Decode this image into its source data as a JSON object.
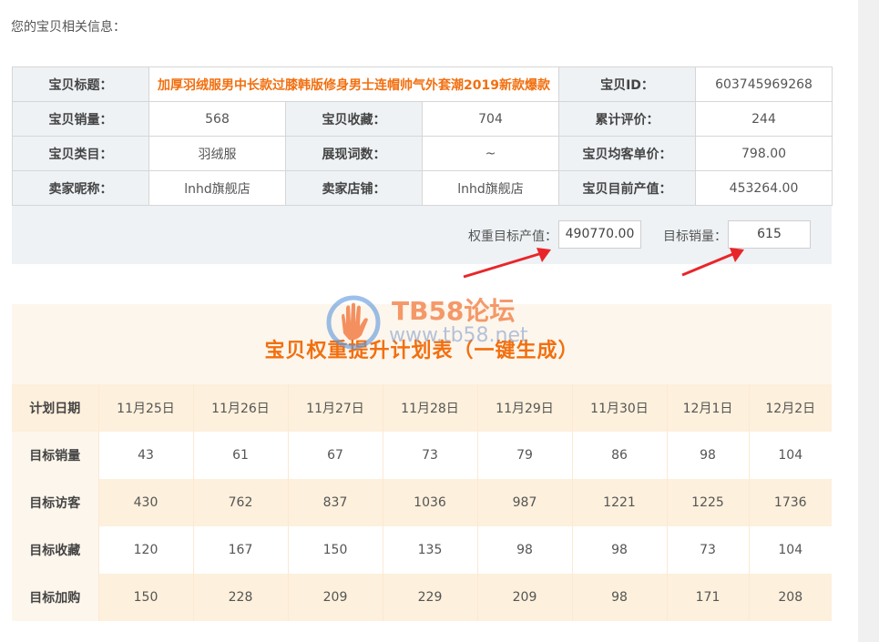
{
  "intro": "您的宝贝相关信息：",
  "info": {
    "rows": [
      [
        {
          "l": "宝贝标题："
        },
        {
          "v": "加厚羽绒服男中长款过膝韩版修身男士连帽帅气外套潮2019新款爆款",
          "title": true,
          "span": 3
        },
        {
          "l": "宝贝ID："
        },
        {
          "v": "603745969268"
        }
      ],
      [
        {
          "l": "宝贝销量："
        },
        {
          "v": "568"
        },
        {
          "l": "宝贝收藏："
        },
        {
          "v": "704"
        },
        {
          "l": "累计评价："
        },
        {
          "v": "244"
        }
      ],
      [
        {
          "l": "宝贝类目："
        },
        {
          "v": "羽绒服"
        },
        {
          "l": "展现词数："
        },
        {
          "v": "~"
        },
        {
          "l": "宝贝均客单价："
        },
        {
          "v": "798.00"
        }
      ],
      [
        {
          "l": "卖家昵称："
        },
        {
          "v": "lnhd旗舰店"
        },
        {
          "l": "卖家店铺："
        },
        {
          "v": "lnhd旗舰店"
        },
        {
          "l": "宝贝目前产值："
        },
        {
          "v": "453264.00"
        }
      ]
    ]
  },
  "target": {
    "weight_label": "权重目标产值：",
    "weight_value": "490770.00",
    "sales_label": "目标销量：",
    "sales_value": "615"
  },
  "watermark": {
    "brand": "TB58论坛",
    "url": "www.tb58.net"
  },
  "plan": {
    "title": "宝贝权重提升计划表（一键生成）",
    "header_label": "计划日期",
    "dates": [
      "11月25日",
      "11月26日",
      "11月27日",
      "11月28日",
      "11月29日",
      "11月30日",
      "12月1日",
      "12月2日"
    ],
    "rows": [
      {
        "label": "目标销量",
        "values": [
          "43",
          "61",
          "67",
          "73",
          "79",
          "86",
          "98",
          "104"
        ]
      },
      {
        "label": "目标访客",
        "values": [
          "430",
          "762",
          "837",
          "1036",
          "987",
          "1221",
          "1225",
          "1736"
        ]
      },
      {
        "label": "目标收藏",
        "values": [
          "120",
          "167",
          "150",
          "135",
          "98",
          "98",
          "73",
          "104"
        ]
      },
      {
        "label": "目标加购",
        "values": [
          "150",
          "228",
          "209",
          "229",
          "209",
          "98",
          "171",
          "208"
        ]
      }
    ]
  },
  "colors": {
    "accent": "#f26f0f",
    "arrow": "#e8262a",
    "label_bg": "#eef2f5",
    "plan_bg": "#fdf6ec"
  }
}
